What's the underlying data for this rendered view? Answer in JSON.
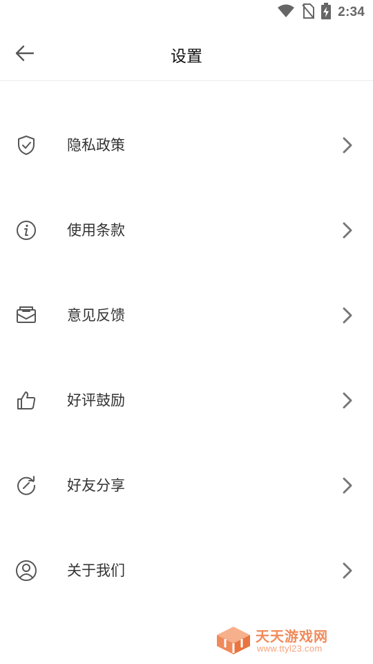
{
  "status_bar": {
    "time": "2:34",
    "icons": [
      "wifi-icon",
      "no-sim-icon",
      "battery-charging-icon"
    ]
  },
  "header": {
    "title": "设置",
    "back_icon": "arrow-left-icon"
  },
  "menu": {
    "items": [
      {
        "label": "隐私政策",
        "icon": "shield-check-icon"
      },
      {
        "label": "使用条款",
        "icon": "info-circle-icon"
      },
      {
        "label": "意见反馈",
        "icon": "mail-tray-icon"
      },
      {
        "label": "好评鼓励",
        "icon": "thumbs-up-icon"
      },
      {
        "label": "好友分享",
        "icon": "refresh-share-icon"
      },
      {
        "label": "关于我们",
        "icon": "user-circle-icon"
      }
    ],
    "chevron_icon": "chevron-right-icon"
  },
  "watermark": {
    "title": "天天游戏网",
    "url": "www.ttyl23.com"
  },
  "colors": {
    "text_primary": "#333333",
    "title": "#111111",
    "icon": "#555555",
    "chevron": "#777777",
    "divider": "#ececec",
    "watermark": "#f08a5a"
  }
}
